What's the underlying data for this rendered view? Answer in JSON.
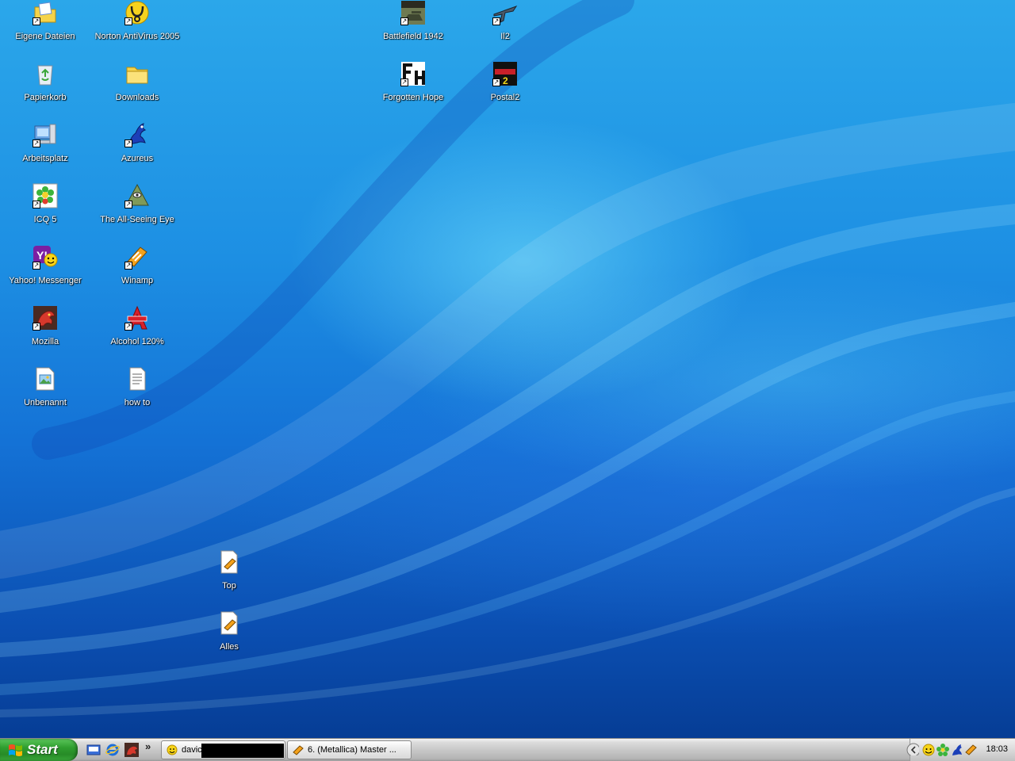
{
  "desktop": {
    "icons": [
      {
        "label": "Eigene Dateien",
        "icon": "documents-folder-icon"
      },
      {
        "label": "Papierkorb",
        "icon": "recycle-bin-icon"
      },
      {
        "label": "Arbeitsplatz",
        "icon": "computer-icon"
      },
      {
        "label": "ICQ 5",
        "icon": "icq-flower-icon"
      },
      {
        "label": "Yahoo! Messenger",
        "icon": "yahoo-messenger-icon"
      },
      {
        "label": "Mozilla",
        "icon": "mozilla-dragon-icon"
      },
      {
        "label": "Unbenannt",
        "icon": "image-file-icon"
      },
      {
        "label": "Norton AntiVirus 2005",
        "icon": "norton-antivirus-icon"
      },
      {
        "label": "Downloads",
        "icon": "folder-icon"
      },
      {
        "label": "Azureus",
        "icon": "azureus-frog-icon"
      },
      {
        "label": "The All-Seeing Eye",
        "icon": "all-seeing-eye-icon"
      },
      {
        "label": "Winamp",
        "icon": "winamp-icon"
      },
      {
        "label": "Alcohol 120%",
        "icon": "alcohol-120-icon"
      },
      {
        "label": "how to",
        "icon": "text-file-icon"
      },
      {
        "label": "Battlefield 1942",
        "icon": "battlefield-1942-icon"
      },
      {
        "label": "Forgotten Hope",
        "icon": "forgotten-hope-icon"
      },
      {
        "label": "Il2",
        "icon": "il2-plane-icon"
      },
      {
        "label": "Postal2",
        "icon": "postal2-icon"
      },
      {
        "label": "Top",
        "icon": "winamp-playlist-file-icon"
      },
      {
        "label": "Alles",
        "icon": "winamp-playlist-file-icon"
      }
    ]
  },
  "taskbar": {
    "start_label": "Start",
    "quick_launch": [
      "show-desktop-icon",
      "internet-explorer-icon",
      "mozilla-icon"
    ],
    "overflow_label": "»",
    "tasks": [
      {
        "label": "davic",
        "icon": "yahoo-messenger-icon"
      },
      {
        "label": "6. (Metallica) Master ...",
        "icon": "winamp-icon"
      }
    ],
    "tray_icons": [
      "tray-expand-icon",
      "yahoo-messenger-icon",
      "icq-flower-icon",
      "azureus-frog-icon",
      "winamp-icon"
    ],
    "clock": "18:03"
  },
  "colors": {
    "desktop_blue": "#1d8fe3",
    "start_green": "#2f9e2f",
    "taskbar_gray": "#c8c8c8"
  }
}
